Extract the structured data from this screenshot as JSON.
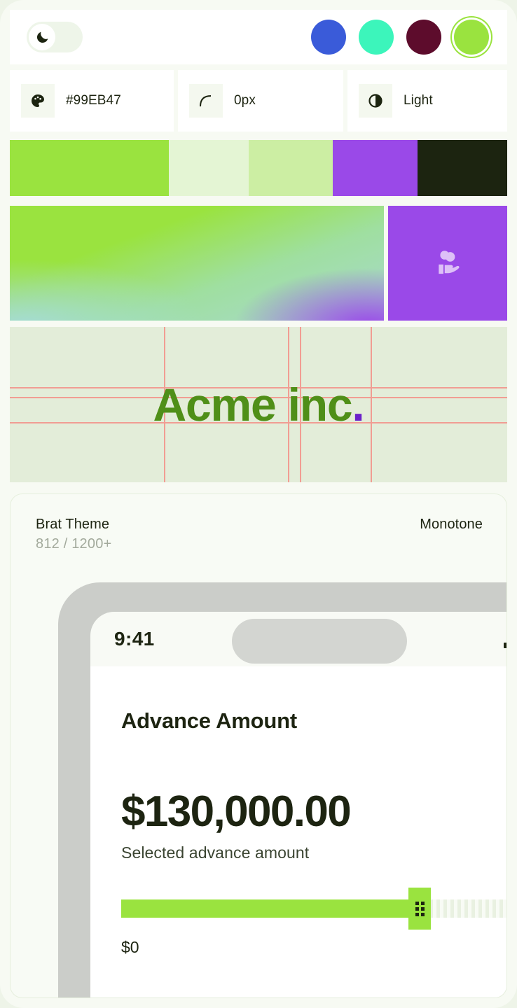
{
  "topbar": {
    "theme_toggle": {
      "name": "dark-mode-toggle",
      "state": "off",
      "icon": "moon-icon"
    },
    "swatches": [
      {
        "name": "blue",
        "color": "#3a5bd9",
        "selected": false
      },
      {
        "name": "mint",
        "color": "#3cf5bb",
        "selected": false
      },
      {
        "name": "maroon",
        "color": "#5d0c2c",
        "selected": false
      },
      {
        "name": "lime",
        "color": "#9ae33f",
        "selected": true
      }
    ]
  },
  "info_cards": [
    {
      "icon": "palette-icon",
      "value": "#99EB47"
    },
    {
      "icon": "corner-radius-icon",
      "value": "0px"
    },
    {
      "icon": "contrast-icon",
      "value": "Light"
    }
  ],
  "palette": [
    {
      "name": "primary",
      "color": "#9ae33f",
      "width_pct": 32
    },
    {
      "name": "surface-lightest",
      "color": "#e4f5d4",
      "width_pct": 16
    },
    {
      "name": "surface-light",
      "color": "#cceea3",
      "width_pct": 17
    },
    {
      "name": "accent-purple",
      "color": "#9a49e8",
      "width_pct": 17
    },
    {
      "name": "ink-dark",
      "color": "#1c2410",
      "width_pct": 18
    }
  ],
  "gradient_banner": {
    "name": "mesh-gradient",
    "stops": [
      "#9ae33f",
      "#a9d9cf",
      "#9a49e8"
    ]
  },
  "icon_tile": {
    "background": "#9a49e8",
    "icon": "hand-holding-coins-icon",
    "icon_color": "#ddc0f7"
  },
  "logo_block": {
    "background": "#e3edd9",
    "guide_color": "#f19d93",
    "text": "Acme inc",
    "dot": ".",
    "text_color": "#4f8f18",
    "dot_color": "#6b21c9"
  },
  "preview": {
    "title": "Brat Theme",
    "subtitle": "812 / 1200+",
    "badge": "Monotone"
  },
  "phone": {
    "statusbar": {
      "time": "9:41",
      "signal_icon": "signal-bars-icon"
    },
    "screen": {
      "heading": "Advance Amount",
      "amount": "$130,000.00",
      "amount_caption": "Selected advance amount",
      "slider": {
        "fill_pct": 72,
        "min_label": "$0"
      }
    }
  }
}
